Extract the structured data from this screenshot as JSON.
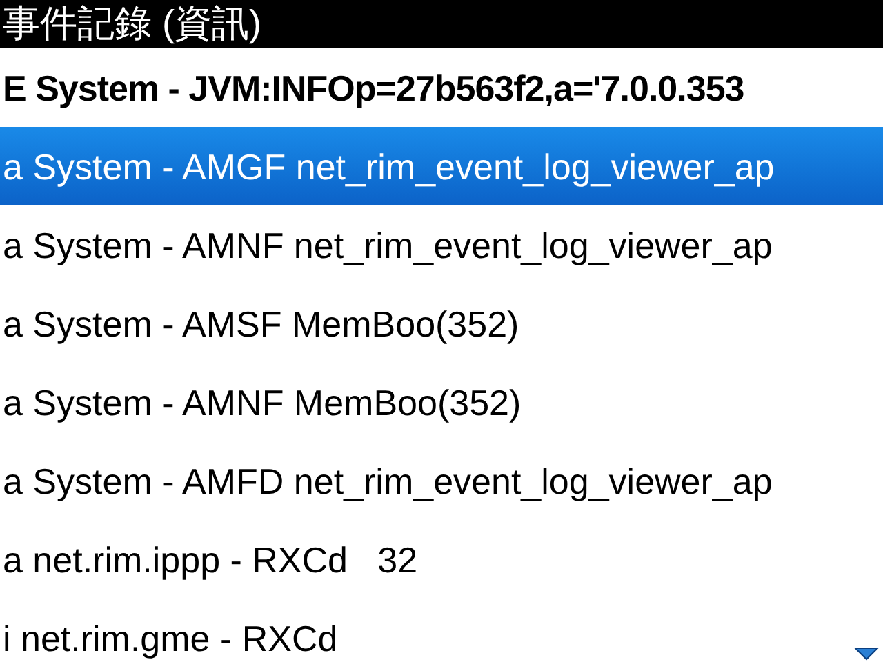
{
  "window": {
    "title": "事件記錄 (資訊)"
  },
  "events": [
    {
      "text": "E System - JVM:INFOp=27b563f2,a='7.0.0.353",
      "bold": true,
      "selected": false
    },
    {
      "text": "a System - AMGF net_rim_event_log_viewer_ap",
      "bold": false,
      "selected": true
    },
    {
      "text": "a System - AMNF net_rim_event_log_viewer_ap",
      "bold": false,
      "selected": false
    },
    {
      "text": "a System - AMSF MemBoo(352)",
      "bold": false,
      "selected": false
    },
    {
      "text": "a System - AMNF MemBoo(352)",
      "bold": false,
      "selected": false
    },
    {
      "text": "a System - AMFD net_rim_event_log_viewer_ap",
      "bold": false,
      "selected": false
    },
    {
      "text": "a net.rim.ippp - RXCd   32",
      "bold": false,
      "selected": false
    },
    {
      "text": "i net.rim.gme - RXCd",
      "bold": false,
      "selected": false
    }
  ]
}
